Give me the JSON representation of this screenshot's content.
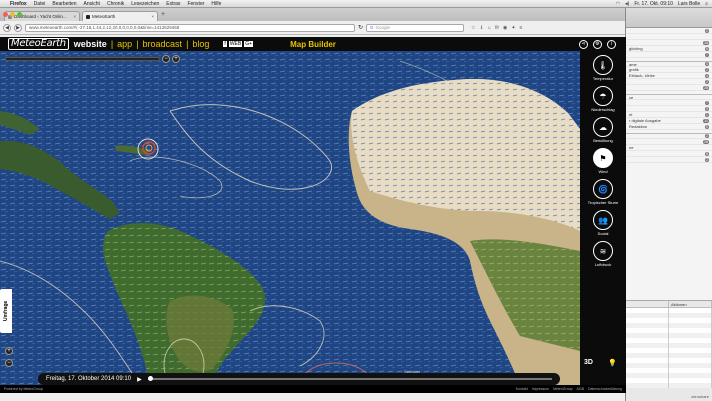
{
  "menubar": {
    "items": [
      "Firefox",
      "Datei",
      "Bearbeiten",
      "Ansicht",
      "Chronik",
      "Lesezeichen",
      "Extras",
      "Fenster",
      "Hilfe"
    ],
    "clock": "Fr. 17. Okt. 09:10",
    "user": "Lars Bolle"
  },
  "browser": {
    "tabs": [
      {
        "label": "Dashboard ‹ Yacht Onlin...",
        "active": false
      },
      {
        "label": "MeteoEarth",
        "active": true
      }
    ],
    "url": "www.meteoearth.com/#/,-27.18,1.44,2,12,20,0,0,0,0,0,0&time=1413529458",
    "search_placeholder": "Google",
    "bookmarks": [
      "Yacht das Segel",
      "TYPO3",
      "Langfeldsurvel hu",
      "YoYo",
      "DK-Intern",
      "zerochant Web-CL...",
      "optivo® broadcast",
      "Facebook",
      "Webapp | Hauseizy",
      "Zfrr",
      "serverfnews",
      "Exaktes Alter ber...",
      "Google Analytics",
      "Yacht.de – Yacht fl..."
    ]
  },
  "site": {
    "logo": "MeteoEarth",
    "nav": {
      "website": "website",
      "app": "app",
      "broadcast": "broadcast",
      "blog": "blog"
    },
    "social": [
      "f",
      "WEB",
      "G+"
    ],
    "map_title": "Map Builder",
    "layers": [
      {
        "icon": "thermometer-icon",
        "glyph": "🌡",
        "label": "Temperatur",
        "active": false
      },
      {
        "icon": "rain-icon",
        "glyph": "☂",
        "label": "Niederschlag",
        "active": false
      },
      {
        "icon": "cloud-icon",
        "glyph": "☁",
        "label": "Bewölkung",
        "active": false
      },
      {
        "icon": "wind-icon",
        "glyph": "⚑",
        "label": "Wind",
        "active": true
      },
      {
        "icon": "storm-icon",
        "glyph": "🌀",
        "label": "Tropischer Sturm",
        "active": false
      },
      {
        "icon": "social-icon",
        "glyph": "👥",
        "label": "Social",
        "active": false
      },
      {
        "icon": "pressure-icon",
        "glyph": "≋",
        "label": "Luftdruck",
        "active": false
      }
    ],
    "umfrage_label": "Umfrage",
    "timeline": {
      "date": "Freitag, 17. Oktober 2014 09:10",
      "day_hint": "Samstag",
      "progress": 0.0
    },
    "btn_3d": "3D",
    "footer_left": "Powered by MeteoGroup",
    "footer_links": [
      "Kontakt",
      "Impressum",
      "MeteoGroup",
      "AGB",
      "Datenschutzerklärung"
    ]
  },
  "rightapp": {
    "rows": [
      {
        "label": "",
        "badge": "2"
      },
      {
        "label": "",
        "badge": ""
      },
      {
        "label": "",
        "badge": "26"
      },
      {
        "label": "gliching",
        "badge": "6"
      },
      {
        "label": "",
        "badge": "7"
      },
      {
        "label": "ame",
        "badge": "4"
      },
      {
        "label": "grafik",
        "badge": "2"
      },
      {
        "label": "Eltdach, Ulrike",
        "badge": "4"
      },
      {
        "label": "",
        "badge": "2"
      },
      {
        "label": "",
        "badge": "28"
      },
      {
        "label": "ce",
        "badge": ""
      },
      {
        "label": "",
        "badge": "7"
      },
      {
        "label": "",
        "badge": "9"
      },
      {
        "label": "nt",
        "badge": "1"
      },
      {
        "label": "r digitale Ausgabe",
        "badge": "11"
      },
      {
        "label": "Redaktion",
        "badge": "5"
      },
      {
        "label": "",
        "badge": "2"
      },
      {
        "label": "",
        "badge": "28"
      },
      {
        "label": "ne",
        "badge": ""
      },
      {
        "label": "",
        "badge": "8"
      },
      {
        "label": "",
        "badge": "2"
      }
    ],
    "bottom_header": [
      "",
      "Aktionen"
    ],
    "brand": "zeroshare"
  }
}
